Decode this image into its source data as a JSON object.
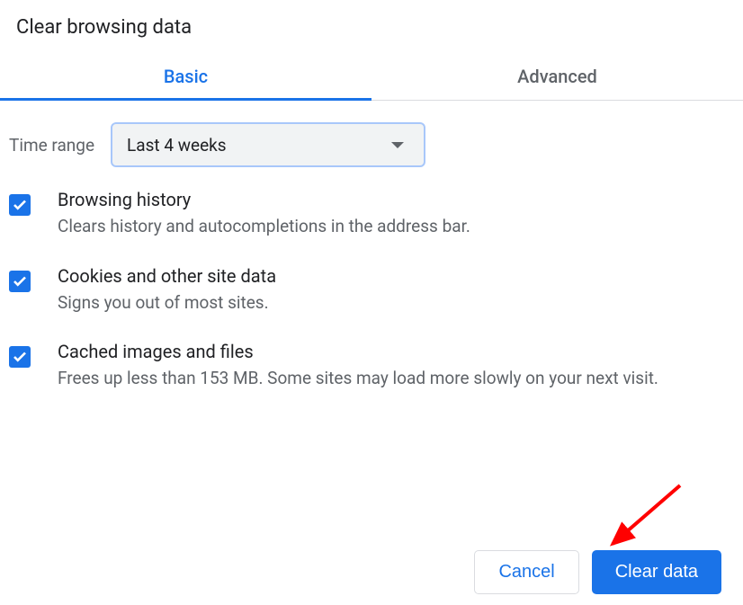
{
  "dialog": {
    "title": "Clear browsing data"
  },
  "tabs": {
    "basic": "Basic",
    "advanced": "Advanced"
  },
  "timeRange": {
    "label": "Time range",
    "value": "Last 4 weeks"
  },
  "options": [
    {
      "title": "Browsing history",
      "desc": "Clears history and autocompletions in the address bar."
    },
    {
      "title": "Cookies and other site data",
      "desc": "Signs you out of most sites."
    },
    {
      "title": "Cached images and files",
      "desc": "Frees up less than 153 MB. Some sites may load more slowly on your next visit."
    }
  ],
  "buttons": {
    "cancel": "Cancel",
    "clear": "Clear data"
  }
}
